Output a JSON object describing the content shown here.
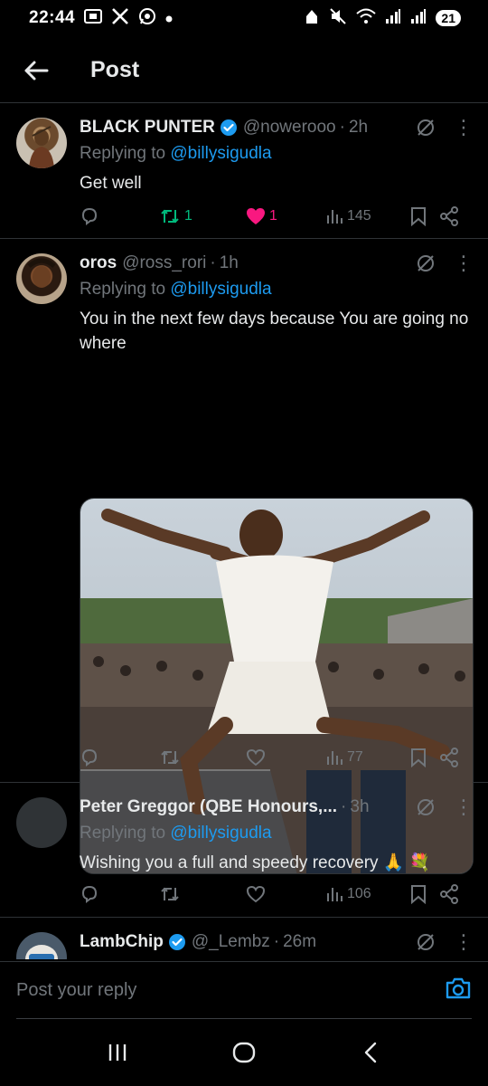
{
  "status_bar": {
    "time": "22:44",
    "battery": "21",
    "left_icons": [
      "screenshot-icon",
      "x-icon",
      "whatsapp-icon",
      "dot"
    ],
    "right_icons": [
      "alarm-icon",
      "mute-icon",
      "wifi-icon",
      "signal-icon",
      "signal-icon"
    ]
  },
  "header": {
    "title": "Post"
  },
  "tweets": [
    {
      "name": "BLACK PUNTER",
      "verified": true,
      "handle": "@nowerooo",
      "time": "2h",
      "replying_prefix": "Replying to",
      "replying_to": "@billysigudla",
      "text": "Get well",
      "retweets": "1",
      "likes": "1",
      "views": "145",
      "retweet_color": "#00ba7c",
      "like_color": "#f91880"
    },
    {
      "name": "oros",
      "verified": false,
      "handle": "@ross_rori",
      "time": "1h",
      "replying_prefix": "Replying to",
      "replying_to": "@billysigudla",
      "text": "You in the next few days because You are going no where",
      "has_media": true,
      "views": "77"
    },
    {
      "name": "Peter Greggor (QBE Honours,...",
      "verified": false,
      "handle": "",
      "time": "3h",
      "replying_prefix": "Replying to",
      "replying_to": "@billysigudla",
      "text": "Wishing you a full and speedy recovery 🙏 💐",
      "views": "106"
    },
    {
      "name": "LambChip",
      "verified": true,
      "handle": "@_Lembz",
      "time": "26m"
    }
  ],
  "reply_bar": {
    "placeholder": "Post your reply"
  },
  "colors": {
    "accent": "#1d9bf0",
    "muted": "#71767b",
    "text": "#e7e9ea",
    "border": "#2f3336",
    "background": "#000000"
  }
}
